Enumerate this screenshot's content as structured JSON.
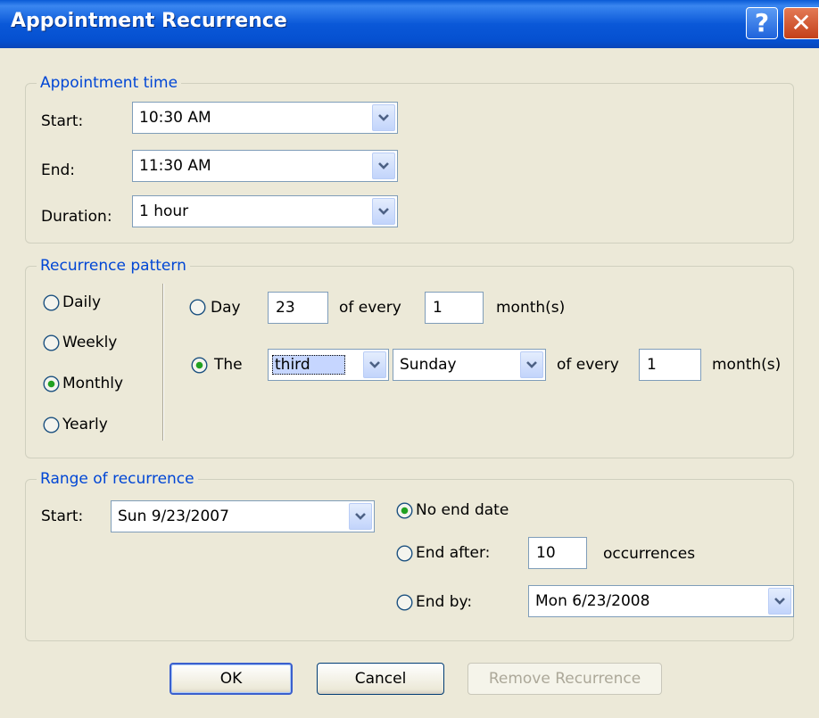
{
  "window": {
    "title": "Appointment Recurrence",
    "help_glyph": "?",
    "close_glyph": "✕"
  },
  "appointment_time": {
    "legend": "Appointment time",
    "start_label": "Start:",
    "start_value": "10:30 AM",
    "end_label": "End:",
    "end_value": "11:30 AM",
    "duration_label": "Duration:",
    "duration_value": "1 hour"
  },
  "recurrence_pattern": {
    "legend": "Recurrence pattern",
    "frequencies": [
      {
        "label": "Daily",
        "selected": false
      },
      {
        "label": "Weekly",
        "selected": false
      },
      {
        "label": "Monthly",
        "selected": true
      },
      {
        "label": "Yearly",
        "selected": false
      }
    ],
    "day_option": {
      "label": "Day",
      "day_value": "23",
      "of_every": "of every",
      "months_value": "1",
      "months_suffix": "month(s)",
      "selected": false
    },
    "the_option": {
      "label": "The",
      "ordinal_value": "third",
      "weekday_value": "Sunday",
      "of_every": "of every",
      "months_value": "1",
      "months_suffix": "month(s)",
      "selected": true
    }
  },
  "range_of_recurrence": {
    "legend": "Range of recurrence",
    "start_label": "Start:",
    "start_value": "Sun 9/23/2007",
    "no_end_label": "No end date",
    "end_after_label": "End after:",
    "end_after_value": "10",
    "occurrences_label": "occurrences",
    "end_by_label": "End by:",
    "end_by_value": "Mon 6/23/2008",
    "selected": "no_end"
  },
  "buttons": {
    "ok": "OK",
    "cancel": "Cancel",
    "remove": "Remove Recurrence"
  },
  "colors": {
    "title_bar": "#0a58d8",
    "group_legend": "#0046d5",
    "dialog_bg": "#ece9d8"
  }
}
